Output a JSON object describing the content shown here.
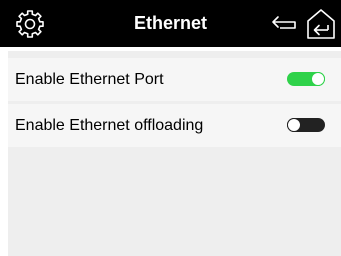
{
  "header": {
    "title": "Ethernet",
    "settings_icon": "gear-icon",
    "back_icon": "back-arrow-icon",
    "home_icon": "home-icon"
  },
  "settings": [
    {
      "label": "Enable Ethernet Port",
      "enabled": true
    },
    {
      "label": "Enable Ethernet offloading",
      "enabled": false
    }
  ],
  "colors": {
    "header_bg": "#000000",
    "panel_bg": "#eeeeee",
    "row_bg": "#f6f6f6",
    "toggle_on": "#2fd24a",
    "toggle_off": "#222222"
  }
}
